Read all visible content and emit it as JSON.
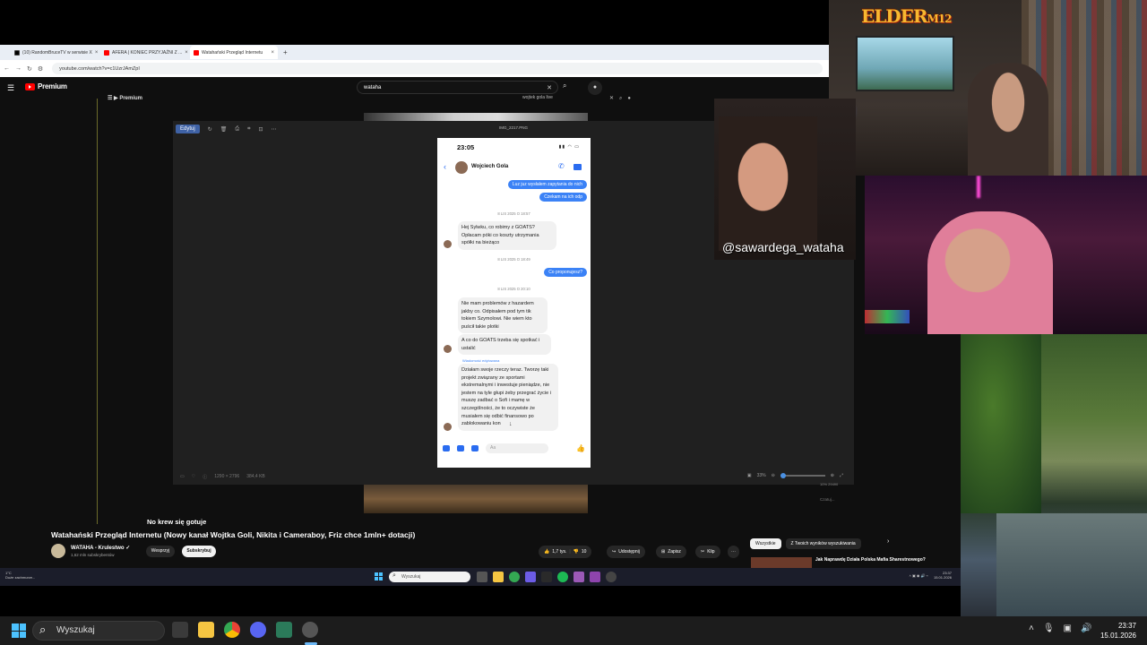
{
  "browser": {
    "tabs": [
      {
        "label": "(10) RandomBruceTV w serwisie X",
        "color": "#000000"
      },
      {
        "label": "AFERA | KONIEC PRZYJAŹNI Z ...",
        "color": "#ff0000"
      },
      {
        "label": "Watahański Przegląd Internetu",
        "color": "#ff0000",
        "active": true
      }
    ],
    "new_tab": "+",
    "url": "youtube.com/watch?v=c1UzrJAmZpI"
  },
  "youtube": {
    "logo_label": "Premium",
    "search_value": "wataha",
    "inner_logo": "Premium",
    "inner_search": "wojtek gola live",
    "subtitle": "No krew się gotuje",
    "video_title": "Watahański Przegląd Internetu (Nowy kanał Wojtka Goli, Nikita i Cameraboy, Friz chce 1mln+ dotacji)",
    "channel_name": "WATAHA - Krulestwo",
    "channel_subs": "1,62 mln subskrybentów",
    "support_label": "Wesprzyj",
    "subscribe_label": "Subskrybuj",
    "likes": "1,7 tys.",
    "dislikes": "10",
    "share_label": "Udostępnij",
    "save_label": "Zapisz",
    "clip_label": "Klip",
    "more_label": "⋯",
    "chips": [
      "Wszystkie",
      "Z Twoich wyników wyszukiwania"
    ],
    "rec_title": "Jak Naprawdę Działa Polska Mafia Sharestnowego?",
    "side_text_1": "10% 29490",
    "side_text_2": "Czatuj..."
  },
  "viewer": {
    "edit_label": "Edytuj",
    "filename": "IMG_2217.PNG",
    "dimensions": "1290 × 2796",
    "filesize": "384,4 KB",
    "zoom": "33%"
  },
  "phone": {
    "time": "23:05",
    "contact": "Wojciech Gola",
    "msg_out_1": "Luz juz wysłałem zapytania do nich",
    "msg_out_2": "Czekam na ich odp",
    "ts_1": "8 LIS 2025 O 18:57",
    "msg_in_1": "Hej Sylwku, co robimy z GOATS? Opłacam póki co koszty utrzymania spółki na bieżąco",
    "ts_2": "8 LIS 2025 O 18:49",
    "msg_out_3": "Co proponujesz?",
    "ts_3": "8 LIS 2025 O 20:10",
    "msg_in_2": "Nie mam problemów z hazardem jakby co. Odpisałem pod tym tik tokiem Szymolowi. Nie wiem kto puścił takie plotki",
    "msg_in_3": "A co do GOATS trzeba się spotkać i ustalić",
    "edited": "Wiadomość edytowana",
    "msg_in_4": "Działam swoje rzeczy teraz. Tworzę taki projekt związany ze sportami ekstremalnymi i inwestuje pieniądze, nie jestem na tyle głupi żeby przegrać życie i muszę zadbać o Sofi i mamę w szczególności, że to oczywiste że musiałem się odbić finansowo po zablokowaniu kon",
    "input_placeholder": "Aa"
  },
  "inner_taskbar": {
    "weather_temp": "1°C",
    "weather_desc": "Duże zachmurze...",
    "search_label": "Wyszukaj",
    "time": "23:37",
    "date": "15.01.2026"
  },
  "streams": {
    "logo_text": "ELDER",
    "logo_suffix": "M12",
    "overlay_handle": "@sawardega_wataha"
  },
  "outer_taskbar": {
    "search_label": "Wyszukaj",
    "time": "23:37",
    "date": "15.01.2026"
  }
}
